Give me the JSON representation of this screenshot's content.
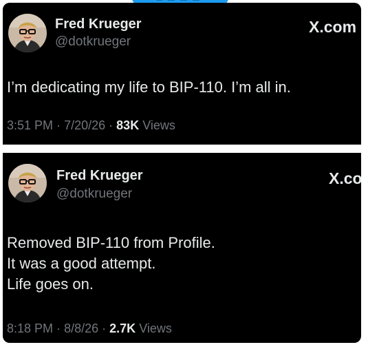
{
  "colors": {
    "background": "#000000",
    "text": "#e7e9ea",
    "muted": "#71767b",
    "accent": "#1d9bf0",
    "divider": "#ffffff"
  },
  "icons": {
    "avatar": "avatar-icon",
    "brand": "x-logo-icon"
  },
  "tweets": [
    {
      "author_name": "Fred Krueger",
      "handle": "@dotkrueger",
      "brand": "X.com",
      "lines": [
        "I’m dedicating my life to BIP-110. I’m all in."
      ],
      "time": "3:51 PM",
      "date": "7/20/26",
      "views_count": "83K",
      "views_label": "Views",
      "sep": "·"
    },
    {
      "author_name": "Fred Krueger",
      "handle": "@dotkrueger",
      "brand": "X.co",
      "lines": [
        "Removed BIP-110 from Profile.",
        "It was a good attempt.",
        "Life goes on."
      ],
      "time": "8:18 PM",
      "date": "8/8/26",
      "views_count": "2.7K",
      "views_label": "Views",
      "sep": "·"
    }
  ]
}
